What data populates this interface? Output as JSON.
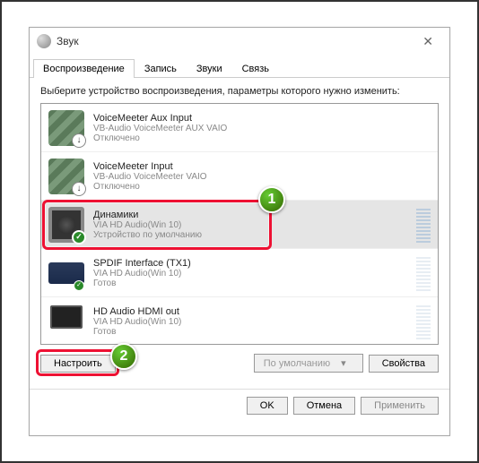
{
  "window": {
    "title": "Звук"
  },
  "tabs": {
    "playback": "Воспроизведение",
    "record": "Запись",
    "sounds": "Звуки",
    "comm": "Связь"
  },
  "instruction": "Выберите устройство воспроизведения, параметры которого нужно изменить:",
  "devices": [
    {
      "name": "VoiceMeeter Aux Input",
      "desc": "VB-Audio VoiceMeeter AUX VAIO",
      "status": "Отключено"
    },
    {
      "name": "VoiceMeeter Input",
      "desc": "VB-Audio VoiceMeeter VAIO",
      "status": "Отключено"
    },
    {
      "name": "Динамики",
      "desc": "VIA HD Audio(Win 10)",
      "status": "Устройство по умолчанию"
    },
    {
      "name": "SPDIF Interface (TX1)",
      "desc": "VIA HD Audio(Win 10)",
      "status": "Готов"
    },
    {
      "name": "HD Audio HDMI out",
      "desc": "VIA HD Audio(Win 10)",
      "status": "Готов"
    }
  ],
  "buttons": {
    "configure": "Настроить",
    "default": "По умолчанию",
    "properties": "Свойства",
    "ok": "OK",
    "cancel": "Отмена",
    "apply": "Применить"
  },
  "markers": {
    "m1": "1",
    "m2": "2"
  }
}
